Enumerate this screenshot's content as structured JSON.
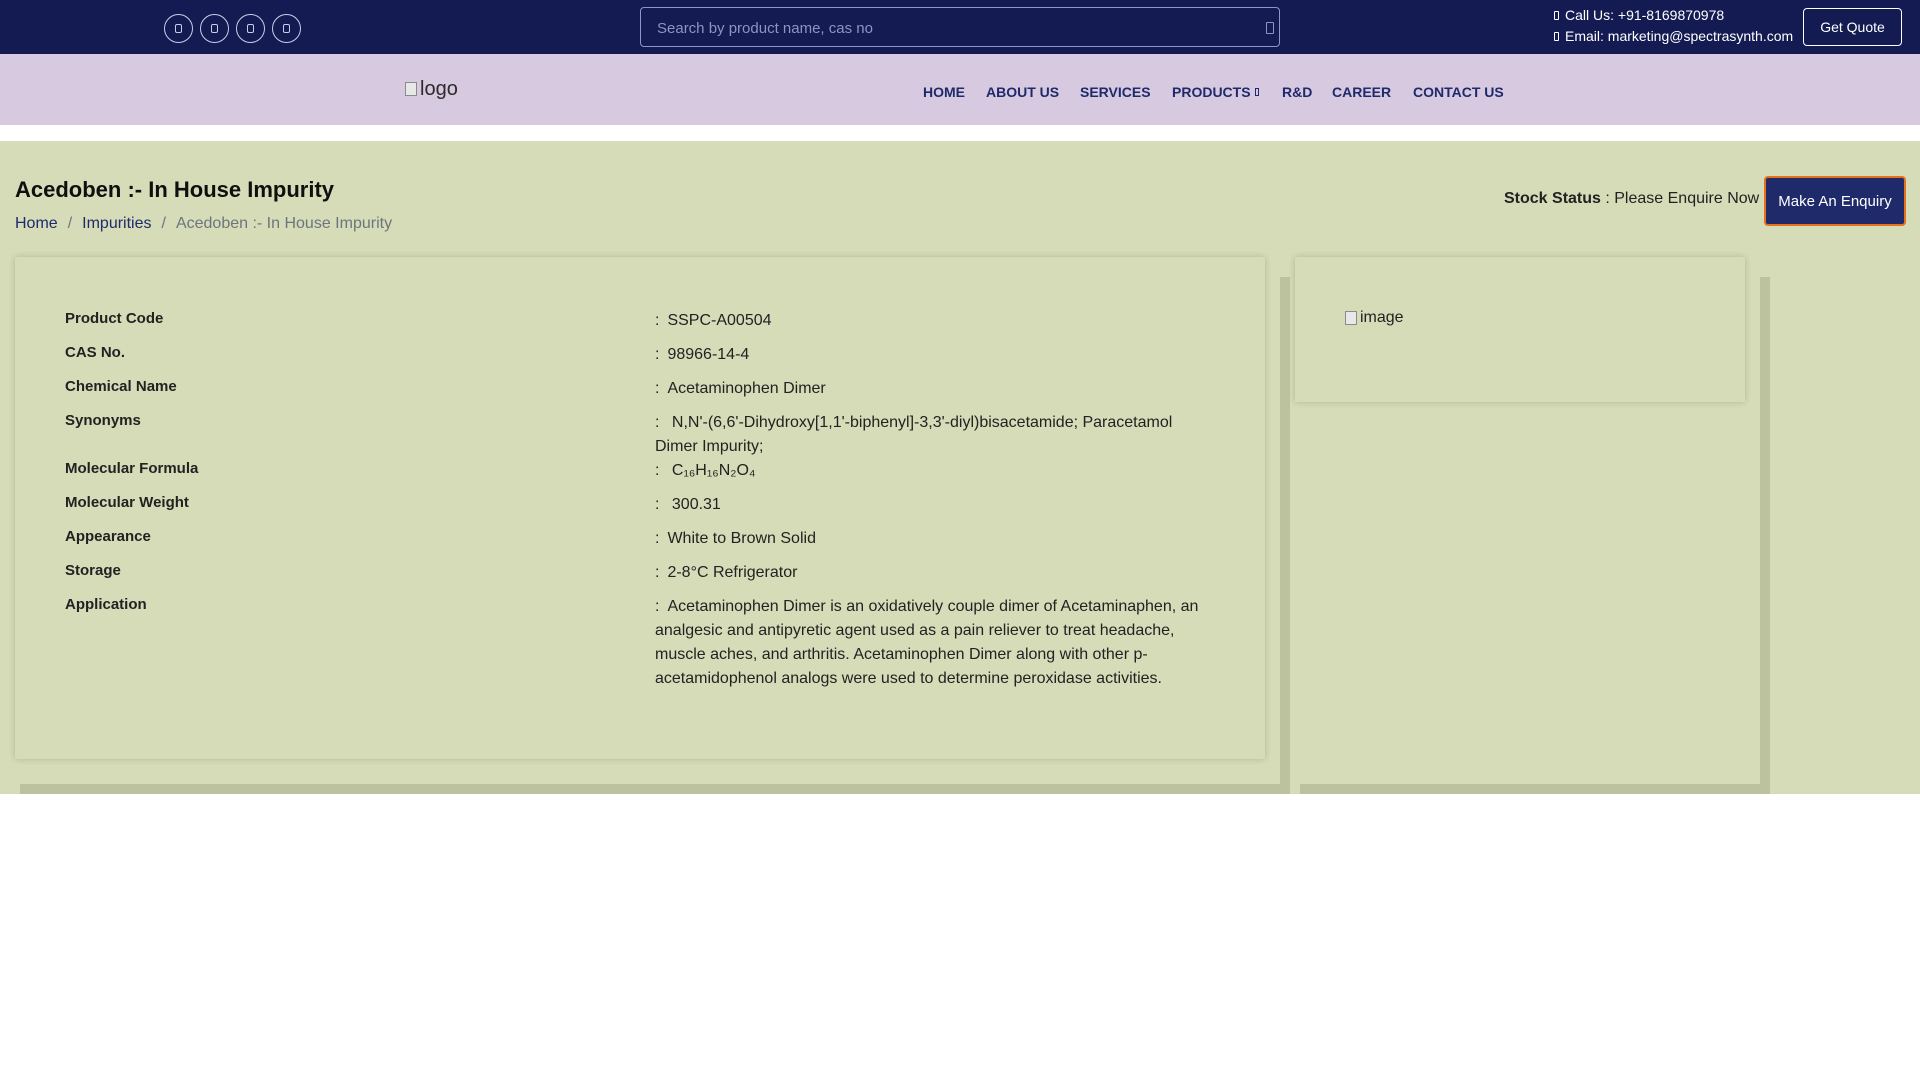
{
  "topbar": {
    "social_icons": [
      "facebook-icon",
      "twitter-icon",
      "linkedin-icon",
      "instagram-icon"
    ],
    "search_placeholder": "Search by product name, cas no",
    "call_label": "Call Us: +91-8169870978",
    "email_label": "Email: marketing@spectrasynth.com",
    "get_quote": "Get Quote"
  },
  "nav": {
    "logo_alt": "logo",
    "items": [
      "HOME",
      "ABOUT US",
      "SERVICES",
      "PRODUCTS",
      "R&D",
      "CAREER",
      "CONTACT US"
    ]
  },
  "page": {
    "title": "Acedoben :- In House Impurity",
    "breadcrumb": [
      "Home",
      "Impurities",
      "Acedoben :- In House Impurity"
    ],
    "stock_label": "Stock Status",
    "stock_value": " : Please Enquire Now",
    "enquiry_button": "Make An Enquiry",
    "image_alt": "image"
  },
  "specs": [
    {
      "label": "Product Code",
      "value": "SSPC-A00504"
    },
    {
      "label": "CAS No.",
      "value": "98966-14-4"
    },
    {
      "label": "Chemical Name",
      "value": "Acetaminophen Dimer"
    },
    {
      "label": "Synonyms",
      "value": "N,N'-(6,6'-Dihydroxy[1,1'-biphenyl]-3,3'-diyl)bisacetamide; Paracetamol Dimer Impurity;"
    },
    {
      "label": "Molecular Formula",
      "value": "C₁₆H₁₆N₂O₄"
    },
    {
      "label": "Molecular Weight",
      "value": "300.31"
    },
    {
      "label": "Appearance",
      "value": "White to Brown Solid"
    },
    {
      "label": "Storage",
      "value": "2-8°C Refrigerator"
    },
    {
      "label": "Application",
      "value": "Acetaminophen Dimer is an oxidatively couple dimer of Acetaminaphen, an analgesic and antipyretic agent used as a pain reliever to treat headache, muscle aches, and arthritis. Acetaminophen Dimer along with other p-acetamidophenol analogs were used to determine peroxidase activities."
    }
  ],
  "colors": {
    "topbar": "#131b52",
    "navbar": "#d7c9e0",
    "main_bg": "#d6dcb8",
    "accent_border": "#e7711b"
  }
}
